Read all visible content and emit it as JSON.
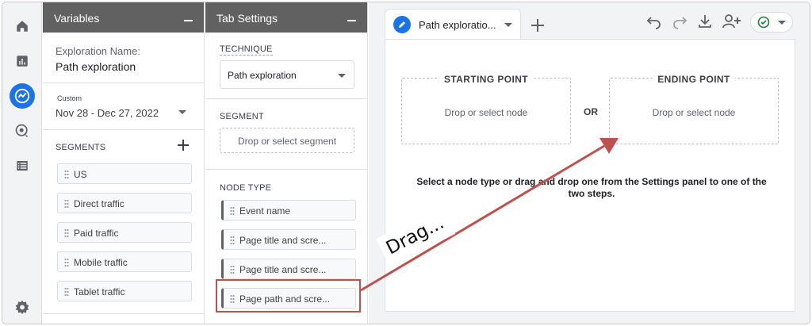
{
  "colors": {
    "accent": "#1a73e8",
    "panel_header": "#616161",
    "annotation": "#c0504d",
    "success": "#188038"
  },
  "rail": {
    "items": [
      {
        "icon": "home-icon"
      },
      {
        "icon": "reports-icon"
      },
      {
        "icon": "explore-icon",
        "active": true
      },
      {
        "icon": "advertising-icon"
      },
      {
        "icon": "configure-icon"
      }
    ],
    "bottom_icon": "settings-gear-icon"
  },
  "variables_panel": {
    "title": "Variables",
    "exploration_name_label": "Exploration Name:",
    "exploration_name": "Path exploration",
    "date_badge": "Custom",
    "date_range": "Nov 28 - Dec 27, 2022",
    "segments_label": "SEGMENTS",
    "segments": [
      "US",
      "Direct traffic",
      "Paid traffic",
      "Mobile traffic",
      "Tablet traffic"
    ]
  },
  "tab_settings": {
    "title": "Tab Settings",
    "technique_label": "TECHNIQUE",
    "technique_value": "Path exploration",
    "segment_label": "SEGMENT",
    "segment_placeholder": "Drop or select segment",
    "node_type_label": "NODE TYPE",
    "node_types": [
      "Event name",
      "Page title and scre...",
      "Page title and scre...",
      "Page path and scre..."
    ]
  },
  "canvas": {
    "tab_label": "Path exploratio...",
    "toolbar_icons": [
      "undo-icon",
      "redo-icon",
      "download-icon",
      "share-user-icon",
      "check-status-icon"
    ],
    "starting_point_title": "STARTING POINT",
    "ending_point_title": "ENDING POINT",
    "drop_node_text": "Drop or select node",
    "or_label": "OR",
    "hint_text": "Select a node type or drag and drop one from the Settings panel to one of the two steps."
  },
  "annotation": {
    "drag_label": "Drag..."
  }
}
